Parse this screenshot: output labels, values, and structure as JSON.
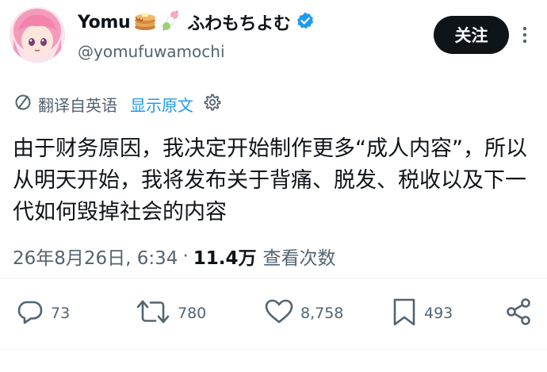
{
  "author": {
    "display_name": "Yomu",
    "name_suffix": "ふわもちよむ",
    "handle": "@yomufuwamochi"
  },
  "follow_label": "关注",
  "translation": {
    "label": "翻译自英语",
    "show_original": "显示原文"
  },
  "tweet": {
    "text": "由于财务原因，我决定开始制作更多“成人内容”，所以从明天开始，我将发布关于背痛、脱发、税收以及下一代如何毁掉社会的内容"
  },
  "meta": {
    "time": "26年8月26日, 6:34",
    "dot": "·",
    "views": "11.4万",
    "views_label": "查看次数"
  },
  "actions": {
    "replies": "73",
    "retweets": "780",
    "likes": "8,758",
    "bookmarks": "493"
  },
  "colors": {
    "accent": "#1d9bf0",
    "text": "#0f1419",
    "muted": "#536471"
  },
  "icons": [
    "translate-icon",
    "settings-icon",
    "reply-icon",
    "retweet-icon",
    "like-icon",
    "bookmark-icon",
    "share-icon",
    "more-icon",
    "verified-icon"
  ]
}
